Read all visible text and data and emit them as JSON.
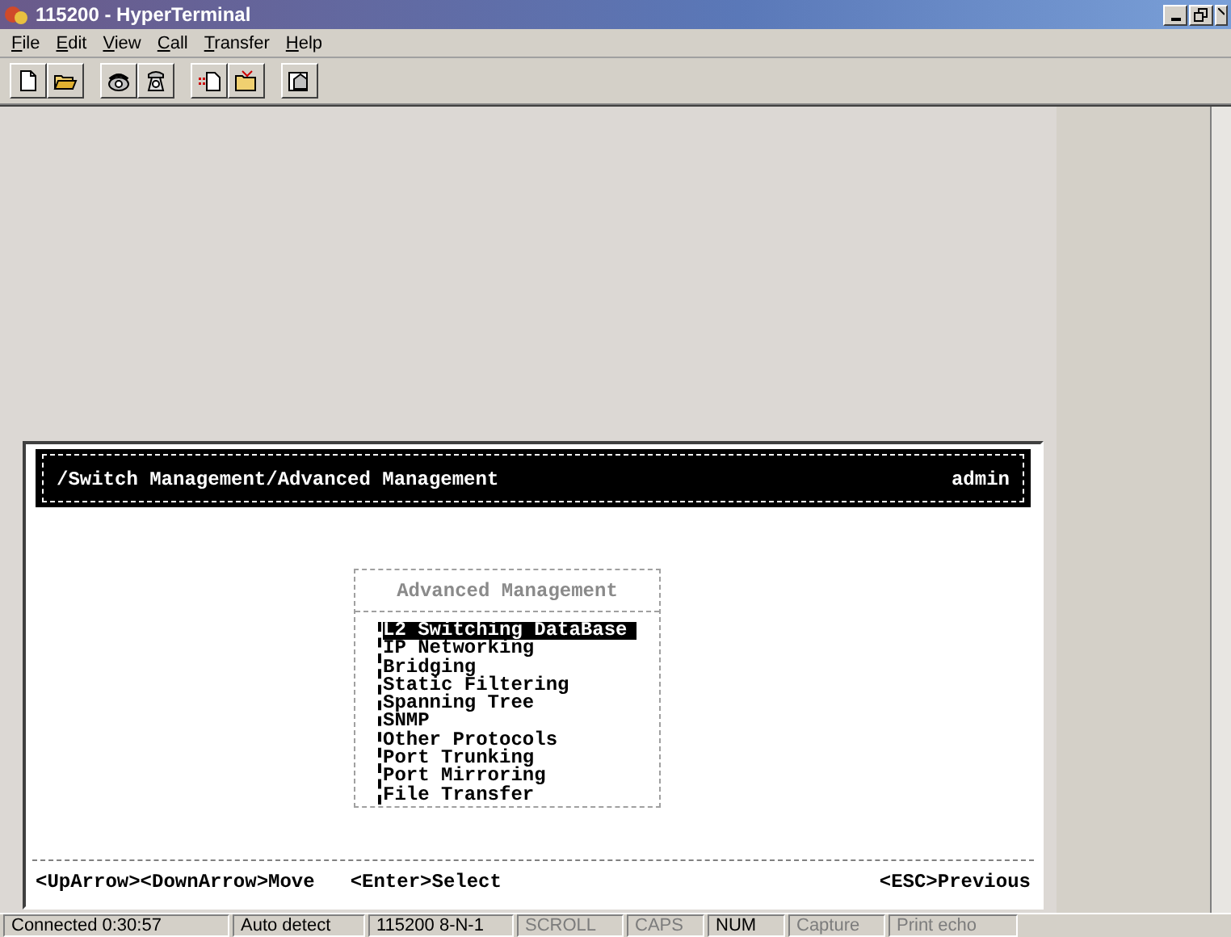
{
  "window": {
    "title": "115200 - HyperTerminal"
  },
  "menu": [
    {
      "label": "File"
    },
    {
      "label": "Edit"
    },
    {
      "label": "View"
    },
    {
      "label": "Call"
    },
    {
      "label": "Transfer"
    },
    {
      "label": "Help"
    }
  ],
  "toolbar": [
    {
      "kind": "new"
    },
    {
      "kind": "open"
    },
    {
      "kind": "sep"
    },
    {
      "kind": "call"
    },
    {
      "kind": "hangup"
    },
    {
      "kind": "sep"
    },
    {
      "kind": "send"
    },
    {
      "kind": "receive"
    },
    {
      "kind": "sep"
    },
    {
      "kind": "properties"
    }
  ],
  "terminal": {
    "path": "/Switch Management/Advanced Management",
    "user": "admin",
    "menu_title": "Advanced Management",
    "menu_items": [
      {
        "label": "L2 Switching DataBase",
        "selected": true
      },
      {
        "label": "IP Networking",
        "selected": false
      },
      {
        "label": "Bridging",
        "selected": false
      },
      {
        "label": "Static Filtering",
        "selected": false
      },
      {
        "label": "Spanning Tree",
        "selected": false
      },
      {
        "label": "SNMP",
        "selected": false
      },
      {
        "label": "Other Protocols",
        "selected": false
      },
      {
        "label": "Port Trunking",
        "selected": false
      },
      {
        "label": "Port Mirroring",
        "selected": false
      },
      {
        "label": "File Transfer",
        "selected": false
      }
    ],
    "hints": [
      "<UpArrow><DownArrow>Move",
      "<Enter>Select",
      "<ESC>Previous"
    ]
  },
  "status_bar": [
    {
      "text": "Connected 0:30:57",
      "disabled": false
    },
    {
      "text": "Auto detect",
      "disabled": false
    },
    {
      "text": "115200 8-N-1",
      "disabled": false
    },
    {
      "text": "SCROLL",
      "disabled": true
    },
    {
      "text": "CAPS",
      "disabled": true
    },
    {
      "text": "NUM",
      "disabled": false
    },
    {
      "text": "Capture",
      "disabled": true
    },
    {
      "text": "Print echo",
      "disabled": true
    }
  ]
}
